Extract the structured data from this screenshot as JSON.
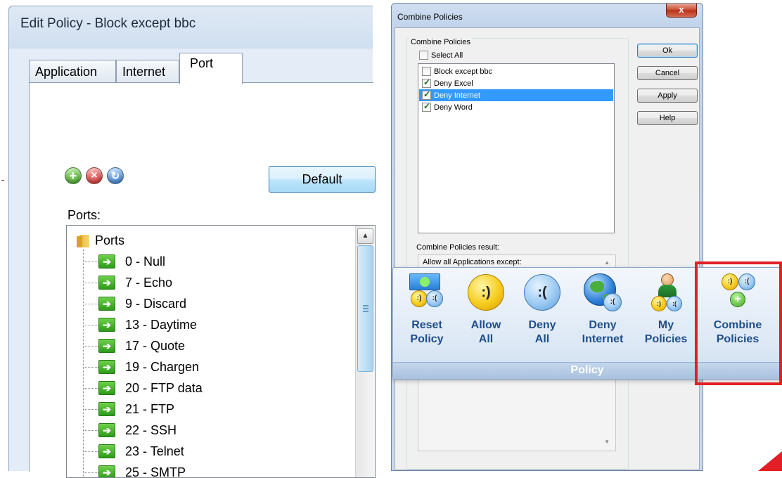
{
  "edit_policy": {
    "title": "Edit Policy - Block except bbc",
    "tabs": [
      {
        "label": "Application",
        "active": false
      },
      {
        "label": "Internet",
        "active": false
      },
      {
        "label": "Port",
        "active": true
      }
    ],
    "toolbar_icons": [
      "add-icon",
      "remove-icon",
      "refresh-icon"
    ],
    "default_button": "Default",
    "ports_label": "Ports:",
    "tree": {
      "root": "Ports",
      "items": [
        "0 - Null",
        "7 - Echo",
        "9 - Discard",
        "13 - Daytime",
        "17 - Quote",
        "19 - Chargen",
        "20 - FTP data",
        "21 - FTP",
        "22 - SSH",
        "23 - Telnet",
        "25 - SMTP"
      ]
    }
  },
  "combine_dialog": {
    "title": "Combine Policies",
    "close_label": "x",
    "group_label": "Combine Policies",
    "select_all_label": "Select All",
    "policies": [
      {
        "label": "Block except bbc",
        "checked": false,
        "selected": false
      },
      {
        "label": "Deny Excel",
        "checked": true,
        "selected": false
      },
      {
        "label": "Deny Internet",
        "checked": true,
        "selected": true
      },
      {
        "label": "Deny Word",
        "checked": true,
        "selected": false
      }
    ],
    "result_label": "Combine Policies result:",
    "result_text": "Allow all Applications except:",
    "buttons": {
      "ok": "Ok",
      "cancel": "Cancel",
      "apply": "Apply",
      "help": "Help"
    }
  },
  "ribbon": {
    "group_label": "Policy",
    "buttons": [
      {
        "label": "Reset\nPolicy",
        "icon": "reset-policy-icon"
      },
      {
        "label": "Allow\nAll",
        "icon": "happy-face-icon"
      },
      {
        "label": "Deny\nAll",
        "icon": "sad-face-icon"
      },
      {
        "label": "Deny\nInternet",
        "icon": "globe-sad-icon"
      },
      {
        "label": "My\nPolicies",
        "icon": "user-policies-icon"
      },
      {
        "label": "Combine\nPolicies",
        "icon": "combine-policies-icon"
      }
    ],
    "highlight_color": "#e21f26"
  }
}
